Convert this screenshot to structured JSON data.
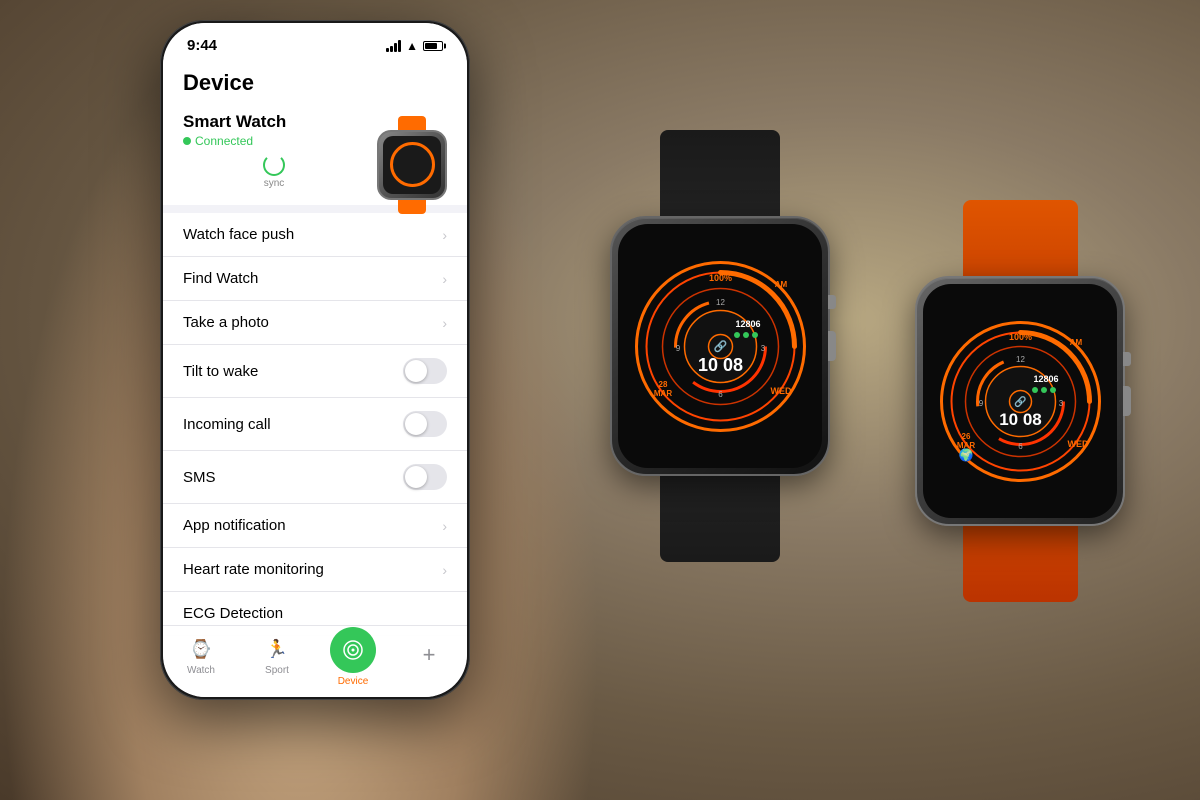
{
  "background": {
    "color": "#7a6a55"
  },
  "phone": {
    "status_bar": {
      "time": "9:44",
      "battery_level": "75%"
    },
    "page_title": "Device",
    "device": {
      "name": "Smart Watch",
      "status": "Connected",
      "sync_label": "sync"
    },
    "menu_items": [
      {
        "label": "Watch face push",
        "type": "arrow"
      },
      {
        "label": "Find Watch",
        "type": "arrow"
      },
      {
        "label": "Take a photo",
        "type": "arrow"
      },
      {
        "label": "Tilt to wake",
        "type": "toggle",
        "value": false
      },
      {
        "label": "Incoming call",
        "type": "toggle",
        "value": false
      },
      {
        "label": "SMS",
        "type": "toggle",
        "value": false
      },
      {
        "label": "App notification",
        "type": "arrow"
      },
      {
        "label": "Heart rate monitoring",
        "type": "arrow"
      },
      {
        "label": "ECG Detection",
        "type": "active_button"
      }
    ],
    "tab_bar": {
      "items": [
        {
          "label": "Watch",
          "icon": "⌚"
        },
        {
          "label": "Sport",
          "icon": "🏃"
        },
        {
          "label": "Device",
          "icon": "📱",
          "active": true
        },
        {
          "label": "+",
          "icon": "+"
        }
      ]
    }
  },
  "watches": {
    "black": {
      "band_color": "black",
      "battery": "100%",
      "am_pm": "AM",
      "steps": "12806",
      "time": "10 08",
      "date": "28 MAR",
      "day": "WED"
    },
    "orange": {
      "band_color": "orange",
      "battery": "100%",
      "am_pm": "AM",
      "steps": "12806",
      "time": "10 08",
      "date": "26 MAR",
      "day": "WED"
    }
  }
}
